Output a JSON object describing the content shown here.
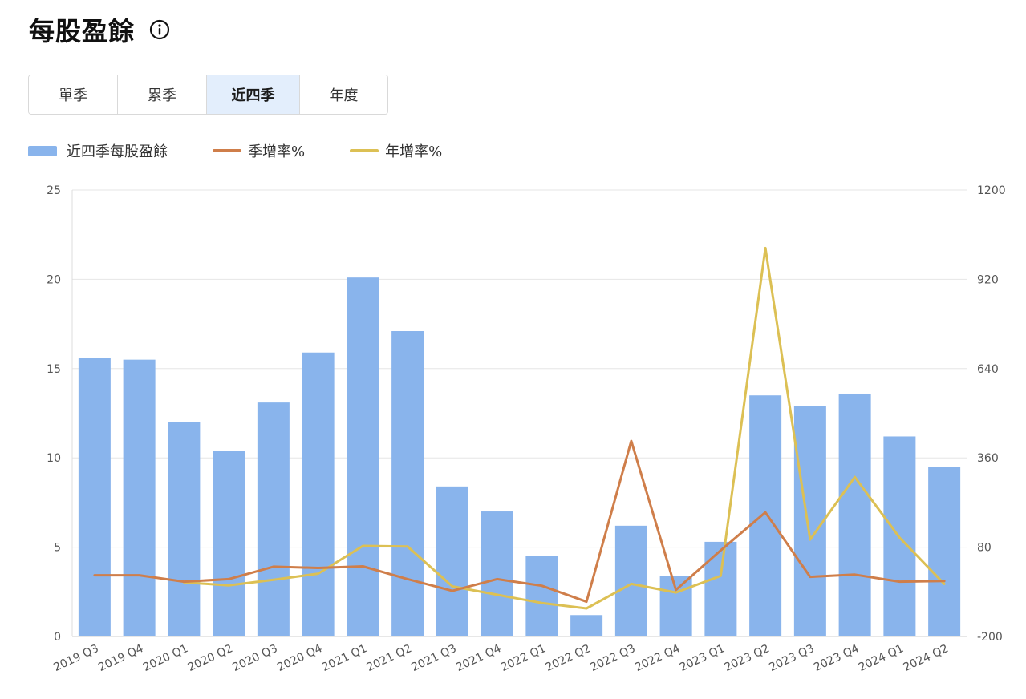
{
  "header": {
    "title": "每股盈餘"
  },
  "tabs": [
    {
      "label": "單季",
      "active": false
    },
    {
      "label": "累季",
      "active": false
    },
    {
      "label": "近四季",
      "active": true
    },
    {
      "label": "年度",
      "active": false
    }
  ],
  "colors": {
    "bar": "#89b4ec",
    "qoq": "#cf7e4a",
    "yoy": "#dcc054",
    "grid": "#e6e6e6"
  },
  "chart_data": {
    "type": "bar",
    "categories": [
      "2019 Q3",
      "2019 Q4",
      "2020 Q1",
      "2020 Q2",
      "2020 Q3",
      "2020 Q4",
      "2021 Q1",
      "2021 Q2",
      "2021 Q3",
      "2021 Q4",
      "2022 Q1",
      "2022 Q2",
      "2022 Q3",
      "2022 Q4",
      "2023 Q1",
      "2023 Q2",
      "2023 Q3",
      "2023 Q4",
      "2024 Q1",
      "2024 Q2"
    ],
    "series": [
      {
        "name": "近四季每股盈餘",
        "type": "bar",
        "axis": "left",
        "values": [
          15.6,
          15.5,
          12.0,
          10.4,
          13.1,
          15.9,
          20.1,
          17.1,
          8.4,
          7.0,
          4.5,
          1.2,
          6.2,
          3.4,
          5.3,
          13.5,
          12.9,
          13.6,
          11.2,
          9.5
        ]
      },
      {
        "name": "季增率%",
        "type": "line",
        "axis": "right",
        "values": [
          -8,
          -8,
          -28,
          -20,
          19,
          15,
          20,
          -20,
          -57,
          -20,
          -41,
          -91,
          413,
          -54,
          70,
          189,
          -13,
          -6,
          -28,
          -26
        ]
      },
      {
        "name": "年增率%",
        "type": "line",
        "axis": "right",
        "values": [
          null,
          null,
          -30,
          -40,
          -22,
          -3,
          84,
          82,
          -43,
          -69,
          -95,
          -112,
          -35,
          -62,
          -10,
          1018,
          104,
          300,
          110,
          -35
        ]
      }
    ],
    "yAxisLeft": {
      "min": 0,
      "max": 25,
      "ticks": [
        0,
        5,
        10,
        15,
        20,
        25
      ]
    },
    "yAxisRight": {
      "min": -200,
      "max": 1200,
      "ticks": [
        -200,
        80,
        360,
        640,
        920,
        1200
      ]
    },
    "grid": true,
    "legend_position": "top-left"
  }
}
